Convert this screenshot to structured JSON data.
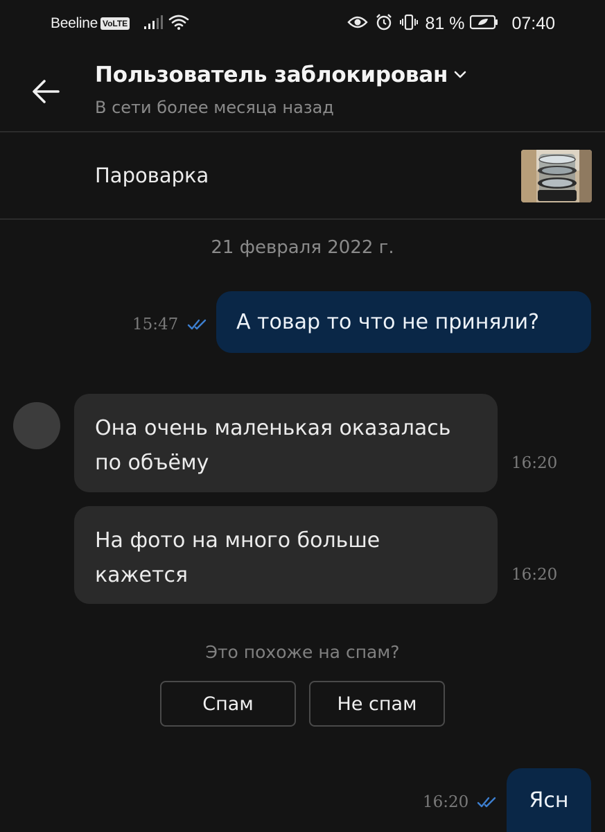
{
  "status_bar": {
    "carrier": "Beeline",
    "volte": "VoLTE",
    "battery_percent": "81 %",
    "time": "07:40"
  },
  "header": {
    "title": "Пользователь заблокирован",
    "subtitle": "В сети более месяца назад"
  },
  "product": {
    "name": "Пароварка"
  },
  "chat": {
    "date_separator": "21 февраля 2022 г.",
    "messages": [
      {
        "direction": "outgoing",
        "text": "А товар то что не приняли?",
        "time": "15:47",
        "read": true
      },
      {
        "direction": "incoming",
        "text": "Она очень маленькая оказалась по объёму",
        "time": "16:20"
      },
      {
        "direction": "incoming",
        "text": "На фото на много больше кажется",
        "time": "16:20"
      },
      {
        "direction": "outgoing",
        "text": "Ясн",
        "time": "16:20",
        "read": true
      }
    ]
  },
  "spam_prompt": {
    "question": "Это похоже на спам?",
    "spam_label": "Спам",
    "not_spam_label": "Не спам"
  },
  "colors": {
    "background": "#141414",
    "outgoing_bubble": "#0a2747",
    "incoming_bubble": "#2a2a2a",
    "read_ticks": "#3d7fd0"
  }
}
